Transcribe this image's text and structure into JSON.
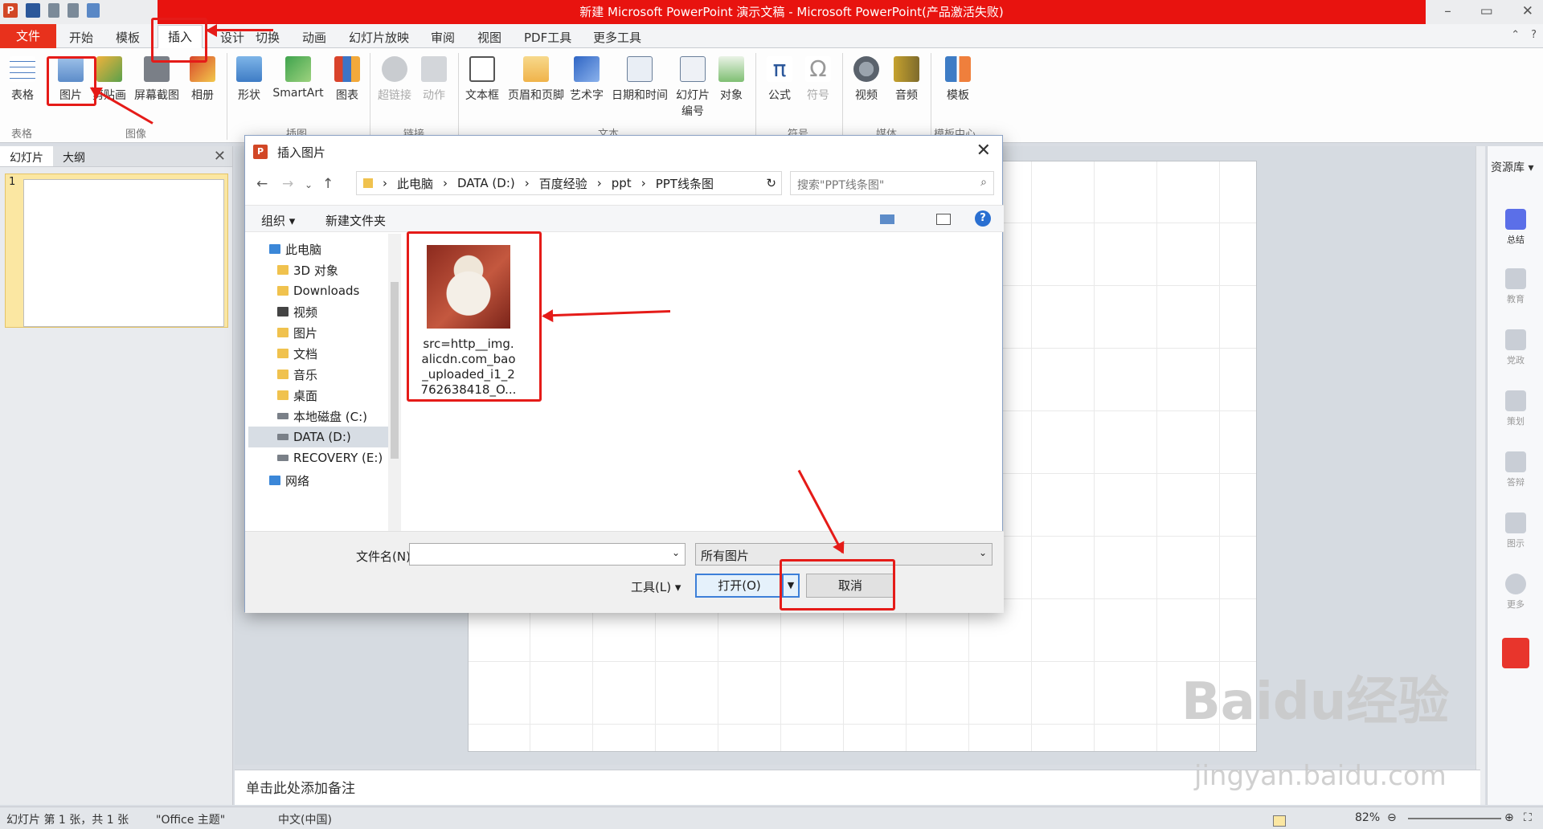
{
  "titlebar": {
    "title": "新建 Microsoft PowerPoint 演示文稿 - Microsoft PowerPoint(产品激活失败)",
    "logo_text": "P",
    "window_controls": [
      "–",
      "▭",
      "✕"
    ]
  },
  "tabs": {
    "file": "文件",
    "items": [
      "开始",
      "模板",
      "插入",
      "设计",
      "切换",
      "动画",
      "幻灯片放映",
      "审阅",
      "视图",
      "PDF工具",
      "更多工具"
    ],
    "active": "插入"
  },
  "ribbon": {
    "buttons": [
      {
        "label": "表格",
        "icon": "table-icon"
      },
      {
        "label": "图片",
        "icon": "picture-icon"
      },
      {
        "label": "剪贴画",
        "icon": "clipart-icon"
      },
      {
        "label": "屏幕截图",
        "icon": "screenshot-icon"
      },
      {
        "label": "相册",
        "icon": "album-icon"
      },
      {
        "label": "形状",
        "icon": "shapes-icon"
      },
      {
        "label": "SmartArt",
        "icon": "smartart-icon"
      },
      {
        "label": "图表",
        "icon": "chart-icon"
      },
      {
        "label": "超链接",
        "icon": "hyperlink-icon"
      },
      {
        "label": "动作",
        "icon": "action-icon"
      },
      {
        "label": "文本框",
        "icon": "textbox-icon"
      },
      {
        "label": "页眉和页脚",
        "icon": "header-footer-icon"
      },
      {
        "label": "艺术字",
        "icon": "wordart-icon"
      },
      {
        "label": "日期和时间",
        "icon": "datetime-icon"
      },
      {
        "label": "幻灯片编号",
        "icon": "slide-number-icon"
      },
      {
        "label": "对象",
        "icon": "object-icon"
      },
      {
        "label": "公式",
        "icon": "equation-icon"
      },
      {
        "label": "符号",
        "icon": "symbol-icon"
      },
      {
        "label": "视频",
        "icon": "video-icon"
      },
      {
        "label": "音频",
        "icon": "audio-icon"
      },
      {
        "label": "模板",
        "icon": "template-icon"
      }
    ],
    "groups": [
      "表格",
      "图像",
      "插图",
      "链接",
      "文本",
      "符号",
      "媒体",
      "模板中心"
    ]
  },
  "leftpane": {
    "tab_slides": "幻灯片",
    "tab_outline": "大纲",
    "slide_number": "1"
  },
  "notes": {
    "placeholder": "单击此处添加备注"
  },
  "rightside": {
    "header": "资源库",
    "items": [
      "总结",
      "教育",
      "党政",
      "策划",
      "答辩",
      "图示",
      "更多"
    ]
  },
  "status": {
    "slide_info": "幻灯片 第 1 张，共 1 张",
    "theme": "\"Office 主题\"",
    "language": "中文(中国)",
    "zoom": "82%"
  },
  "dialog": {
    "title": "插入图片",
    "address": [
      "此电脑",
      "DATA (D:)",
      "百度经验",
      "ppt",
      "PPT线条图"
    ],
    "search_placeholder": "搜索\"PPT线条图\"",
    "organize": "组织 ▾",
    "new_folder": "新建文件夹",
    "tree": [
      "此电脑",
      "3D 对象",
      "Downloads",
      "视频",
      "图片",
      "文档",
      "音乐",
      "桌面",
      "本地磁盘 (C:)",
      "DATA (D:)",
      "RECOVERY (E:)",
      "网络"
    ],
    "file": {
      "name_lines": [
        "src=http__img.",
        "alicdn.com_bao",
        "_uploaded_i1_2",
        "762638418_O..."
      ]
    },
    "filename_label": "文件名(N):",
    "filetype": "所有图片",
    "tools": "工具(L)",
    "open": "打开(O)",
    "cancel": "取消"
  },
  "watermark": {
    "brand": "Baidu经验",
    "url": "jingyan.baidu.com"
  }
}
